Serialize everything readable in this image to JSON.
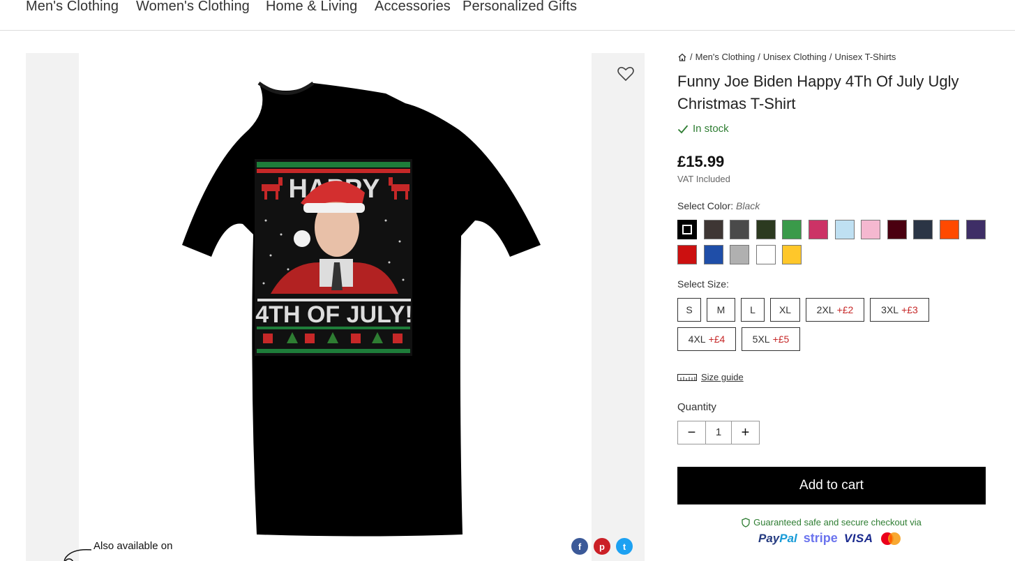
{
  "nav": {
    "items": [
      "Men's Clothing",
      "Women's Clothing",
      "Home & Living",
      "Accessories",
      "Personalized Gifts"
    ]
  },
  "gallery": {
    "print_top_text": "HAPPY",
    "print_bottom_text": "4TH OF JULY!",
    "also_available": "Also available on",
    "share_icons": [
      "facebook-icon",
      "pinterest-icon",
      "twitter-icon"
    ]
  },
  "product": {
    "breadcrumb": [
      "Men's Clothing",
      "Unisex Clothing",
      "Unisex T-Shirts"
    ],
    "title": "Funny Joe Biden Happy 4Th Of July Ugly Christmas T-Shirt",
    "stock": "In stock",
    "price": "£15.99",
    "vat": "VAT Included",
    "color_label": "Select Color:",
    "selected_color": "Black",
    "colors": [
      "#000000",
      "#3e3634",
      "#4a4a4a",
      "#2c3a20",
      "#3a9a4a",
      "#cc3366",
      "#bfe0f2",
      "#f5b8d0",
      "#4a0010",
      "#2b3545",
      "#ff4a00",
      "#3e2e66",
      "#cc1010",
      "#1f4ea8",
      "#b0b0b0",
      "#ffffff",
      "#ffc72a"
    ],
    "size_label": "Select Size:",
    "sizes": [
      {
        "label": "S",
        "extra": ""
      },
      {
        "label": "M",
        "extra": ""
      },
      {
        "label": "L",
        "extra": ""
      },
      {
        "label": "XL",
        "extra": ""
      },
      {
        "label": "2XL",
        "extra": "+£2"
      },
      {
        "label": "3XL",
        "extra": "+£3"
      },
      {
        "label": "4XL",
        "extra": "+£4"
      },
      {
        "label": "5XL",
        "extra": "+£5"
      }
    ],
    "size_guide": "Size guide",
    "quantity_label": "Quantity",
    "quantity": "1",
    "add_to_cart": "Add to cart",
    "secure_text": "Guaranteed safe and secure checkout via",
    "payments": {
      "paypal_a": "Pay",
      "paypal_b": "Pal",
      "stripe": "stripe",
      "visa": "VISA"
    }
  }
}
